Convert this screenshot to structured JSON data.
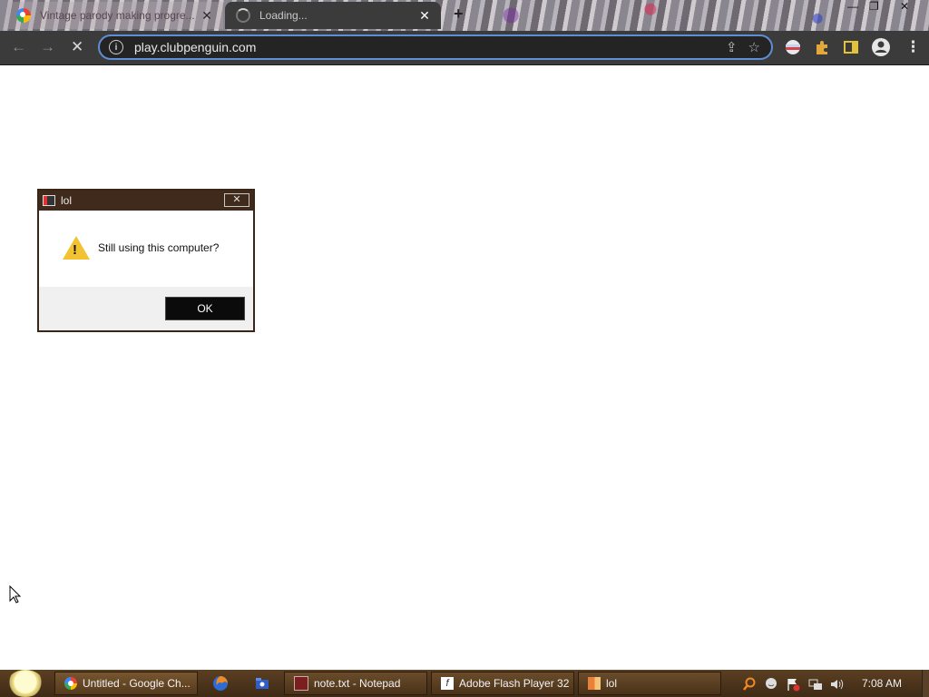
{
  "tabs": [
    {
      "title": "Vintage parody making progre...",
      "close": "✕",
      "icon": "google-icon"
    },
    {
      "title": "Loading...",
      "close": "✕",
      "icon": "loading-spinner-icon"
    }
  ],
  "new_tab": "+",
  "window_controls": {
    "minimize": "—",
    "maximize": "❐",
    "close": "✕"
  },
  "toolbar": {
    "back": "←",
    "forward": "→",
    "reload": "✕",
    "url": "play.clubpenguin.com",
    "info": "i",
    "share": "⇪",
    "bookmark": "☆",
    "menu": "⋮"
  },
  "dialog": {
    "title": "lol",
    "close": "✕",
    "message": "Still using this computer?",
    "ok_label": "OK"
  },
  "taskbar": {
    "items": [
      {
        "label": "Untitled - Google Ch...",
        "icon": "chrome-icon"
      },
      {
        "label": "note.txt - Notepad",
        "icon": "notepad-icon"
      },
      {
        "label": "Adobe Flash Player 32",
        "icon": "flash-icon"
      },
      {
        "label": "lol",
        "icon": "app-icon"
      }
    ],
    "clock": "7:08 AM"
  }
}
